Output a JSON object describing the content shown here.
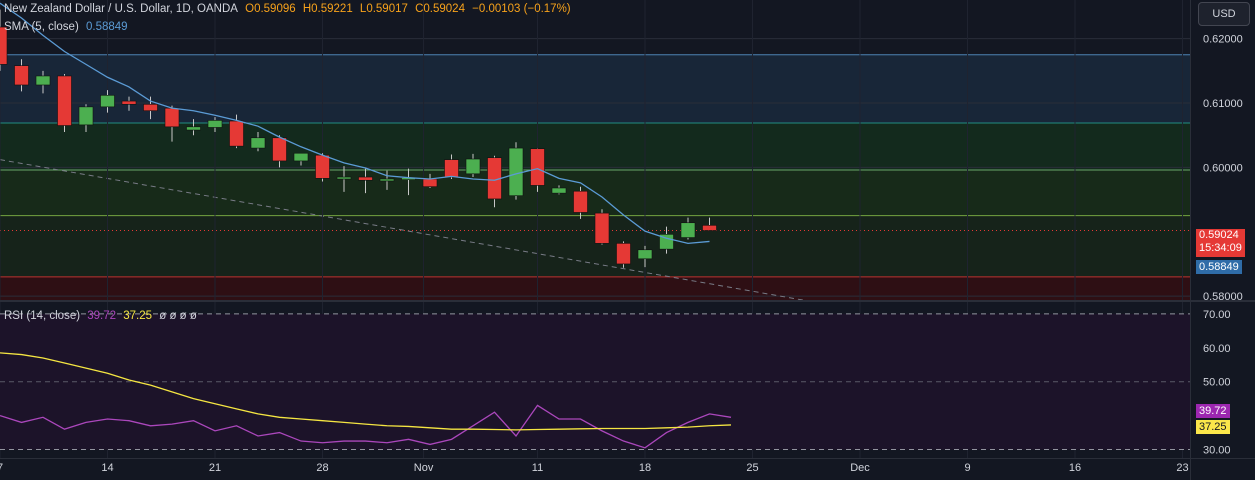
{
  "header": {
    "title": "New Zealand Dollar / U.S. Dollar, 1D, OANDA",
    "o": "O0.59096",
    "h": "H0.59221",
    "l": "L0.59017",
    "c": "C0.59024",
    "chg": "−0.00103 (−0.17%)",
    "sma_label": "SMA (5, close)",
    "sma_value": "0.58849",
    "rsi_label": "RSI (14, close)",
    "rsi_value": "39.72",
    "rsi_ma_value": "37.25",
    "rsi_extra": "ø ø ø ø"
  },
  "currency_button": "USD",
  "price_tags": {
    "last": "0.59024",
    "countdown": "15:34:09",
    "sma": "0.58849",
    "rsi": "39.72",
    "rsi_ma": "37.25"
  },
  "colors": {
    "bg": "#131722",
    "up": "#4caf50",
    "down": "#e53935",
    "sma": "#5b9bd5",
    "rsi": "#ab47bc",
    "rsi_ma": "#f5e642",
    "last_tag": "#e53935",
    "sma_tag": "#2f6ca8",
    "rsi_tag": "#9c27b0",
    "rsi_ma_tag": "#fbe74a"
  },
  "chart_data": [
    {
      "type": "candlestick",
      "symbol": "NZDUSD",
      "interval": "1D",
      "y_tick_labels": [
        "0.62000",
        "0.61000",
        "0.60000",
        "0.58000"
      ],
      "ylim": [
        0.5794,
        0.626
      ],
      "x_tick_labels": [
        {
          "label": "7",
          "index": 0
        },
        {
          "label": "14",
          "index": 5
        },
        {
          "label": "21",
          "index": 10
        },
        {
          "label": "28",
          "index": 15
        },
        {
          "label": "Nov",
          "index": 19.7
        },
        {
          "label": "11",
          "index": 25
        },
        {
          "label": "18",
          "index": 30
        },
        {
          "label": "25",
          "index": 35
        },
        {
          "label": "Dec",
          "index": 40
        },
        {
          "label": "9",
          "index": 45
        },
        {
          "label": "16",
          "index": 50
        },
        {
          "label": "23",
          "index": 55
        }
      ],
      "candles": [
        {
          "o": 0.6218,
          "h": 0.6245,
          "c": 0.616,
          "l": 0.615
        },
        {
          "o": 0.6158,
          "h": 0.6168,
          "c": 0.6128,
          "l": 0.6118
        },
        {
          "o": 0.6128,
          "h": 0.615,
          "c": 0.6142,
          "l": 0.6115
        },
        {
          "o": 0.6142,
          "h": 0.6145,
          "c": 0.6065,
          "l": 0.6055
        },
        {
          "o": 0.6066,
          "h": 0.6098,
          "c": 0.6094,
          "l": 0.6055
        },
        {
          "o": 0.6094,
          "h": 0.612,
          "c": 0.6112,
          "l": 0.6085
        },
        {
          "o": 0.6103,
          "h": 0.611,
          "c": 0.6098,
          "l": 0.6088
        },
        {
          "o": 0.6098,
          "h": 0.611,
          "c": 0.6088,
          "l": 0.6075
        },
        {
          "o": 0.6092,
          "h": 0.6096,
          "c": 0.6063,
          "l": 0.604
        },
        {
          "o": 0.6058,
          "h": 0.6075,
          "c": 0.6063,
          "l": 0.605
        },
        {
          "o": 0.6062,
          "h": 0.6078,
          "c": 0.6073,
          "l": 0.6055
        },
        {
          "o": 0.6072,
          "h": 0.6082,
          "c": 0.6033,
          "l": 0.603
        },
        {
          "o": 0.603,
          "h": 0.6055,
          "c": 0.6046,
          "l": 0.6025
        },
        {
          "o": 0.6046,
          "h": 0.605,
          "c": 0.601,
          "l": 0.6
        },
        {
          "o": 0.601,
          "h": 0.602,
          "c": 0.6022,
          "l": 0.6003
        },
        {
          "o": 0.6019,
          "h": 0.6022,
          "c": 0.5983,
          "l": 0.5978
        },
        {
          "o": 0.5985,
          "h": 0.6002,
          "c": 0.5985,
          "l": 0.5962
        },
        {
          "o": 0.5985,
          "h": 0.5998,
          "c": 0.598,
          "l": 0.596
        },
        {
          "o": 0.598,
          "h": 0.5995,
          "c": 0.5982,
          "l": 0.5965
        },
        {
          "o": 0.5982,
          "h": 0.5998,
          "c": 0.5984,
          "l": 0.5957
        },
        {
          "o": 0.5982,
          "h": 0.599,
          "c": 0.597,
          "l": 0.5968
        },
        {
          "o": 0.6012,
          "h": 0.602,
          "c": 0.5985,
          "l": 0.5982
        },
        {
          "o": 0.599,
          "h": 0.6021,
          "c": 0.6013,
          "l": 0.5985
        },
        {
          "o": 0.6015,
          "h": 0.6018,
          "c": 0.5951,
          "l": 0.5938
        },
        {
          "o": 0.5956,
          "h": 0.6039,
          "c": 0.603,
          "l": 0.595
        },
        {
          "o": 0.6029,
          "h": 0.603,
          "c": 0.5972,
          "l": 0.5962
        },
        {
          "o": 0.596,
          "h": 0.5972,
          "c": 0.5968,
          "l": 0.5958
        },
        {
          "o": 0.5963,
          "h": 0.597,
          "c": 0.593,
          "l": 0.592
        },
        {
          "o": 0.5929,
          "h": 0.5935,
          "c": 0.5882,
          "l": 0.588
        },
        {
          "o": 0.5882,
          "h": 0.5885,
          "c": 0.585,
          "l": 0.5844
        },
        {
          "o": 0.5858,
          "h": 0.5878,
          "c": 0.5872,
          "l": 0.5845
        },
        {
          "o": 0.5873,
          "h": 0.5908,
          "c": 0.5896,
          "l": 0.5866
        },
        {
          "o": 0.5891,
          "h": 0.5922,
          "c": 0.5914,
          "l": 0.5888
        },
        {
          "o": 0.591,
          "h": 0.5922,
          "c": 0.5902,
          "l": 0.5902
        }
      ],
      "sma": [
        0.6255,
        0.6232,
        0.6205,
        0.618,
        0.616,
        0.614,
        0.6125,
        0.6103,
        0.6092,
        0.6088,
        0.6081,
        0.6073,
        0.6064,
        0.6047,
        0.6032,
        0.6019,
        0.6007,
        0.5999,
        0.5987,
        0.5984,
        0.5982,
        0.5986,
        0.5982,
        0.598,
        0.599,
        0.5998,
        0.5983,
        0.5976,
        0.5954,
        0.5926,
        0.5901,
        0.589,
        0.5882,
        0.5885
      ],
      "horizontal_levels": [
        0.6175,
        0.6069,
        0.5996,
        0.5925,
        0.583
      ],
      "trendline": {
        "x": [
          0,
          37.5
        ],
        "y": [
          0.6012,
          0.5793
        ]
      }
    },
    {
      "type": "line",
      "name": "RSI (14, close)",
      "ylim": [
        27.5,
        73.5
      ],
      "y_tick_labels": [
        "70.00",
        "60.00",
        "50.00",
        "30.00"
      ],
      "bands": [
        70,
        50,
        30
      ],
      "series": [
        {
          "name": "RSI",
          "values": [
            40.0,
            38.0,
            39.5,
            36.0,
            38.0,
            39.0,
            38.5,
            37.0,
            37.5,
            38.5,
            35.5,
            37.0,
            34.0,
            35.0,
            32.5,
            32.0,
            32.5,
            32.5,
            32.0,
            33.0,
            31.5,
            33.0,
            37.0,
            41.0,
            34.0,
            43.0,
            39.0,
            39.0,
            35.5,
            32.5,
            30.5,
            35.0,
            38.0,
            40.5,
            39.5
          ]
        },
        {
          "name": "RSI MA",
          "values": [
            58.5,
            58.0,
            57.0,
            55.5,
            54.0,
            52.5,
            50.5,
            49.0,
            47.0,
            45.0,
            43.5,
            42.0,
            40.5,
            39.5,
            39.0,
            38.5,
            38.0,
            37.5,
            37.0,
            36.8,
            36.4,
            36.0,
            36.0,
            35.9,
            35.8,
            35.9,
            36.0,
            36.1,
            36.2,
            36.2,
            36.2,
            36.4,
            36.6,
            37.0,
            37.25
          ]
        }
      ]
    }
  ]
}
